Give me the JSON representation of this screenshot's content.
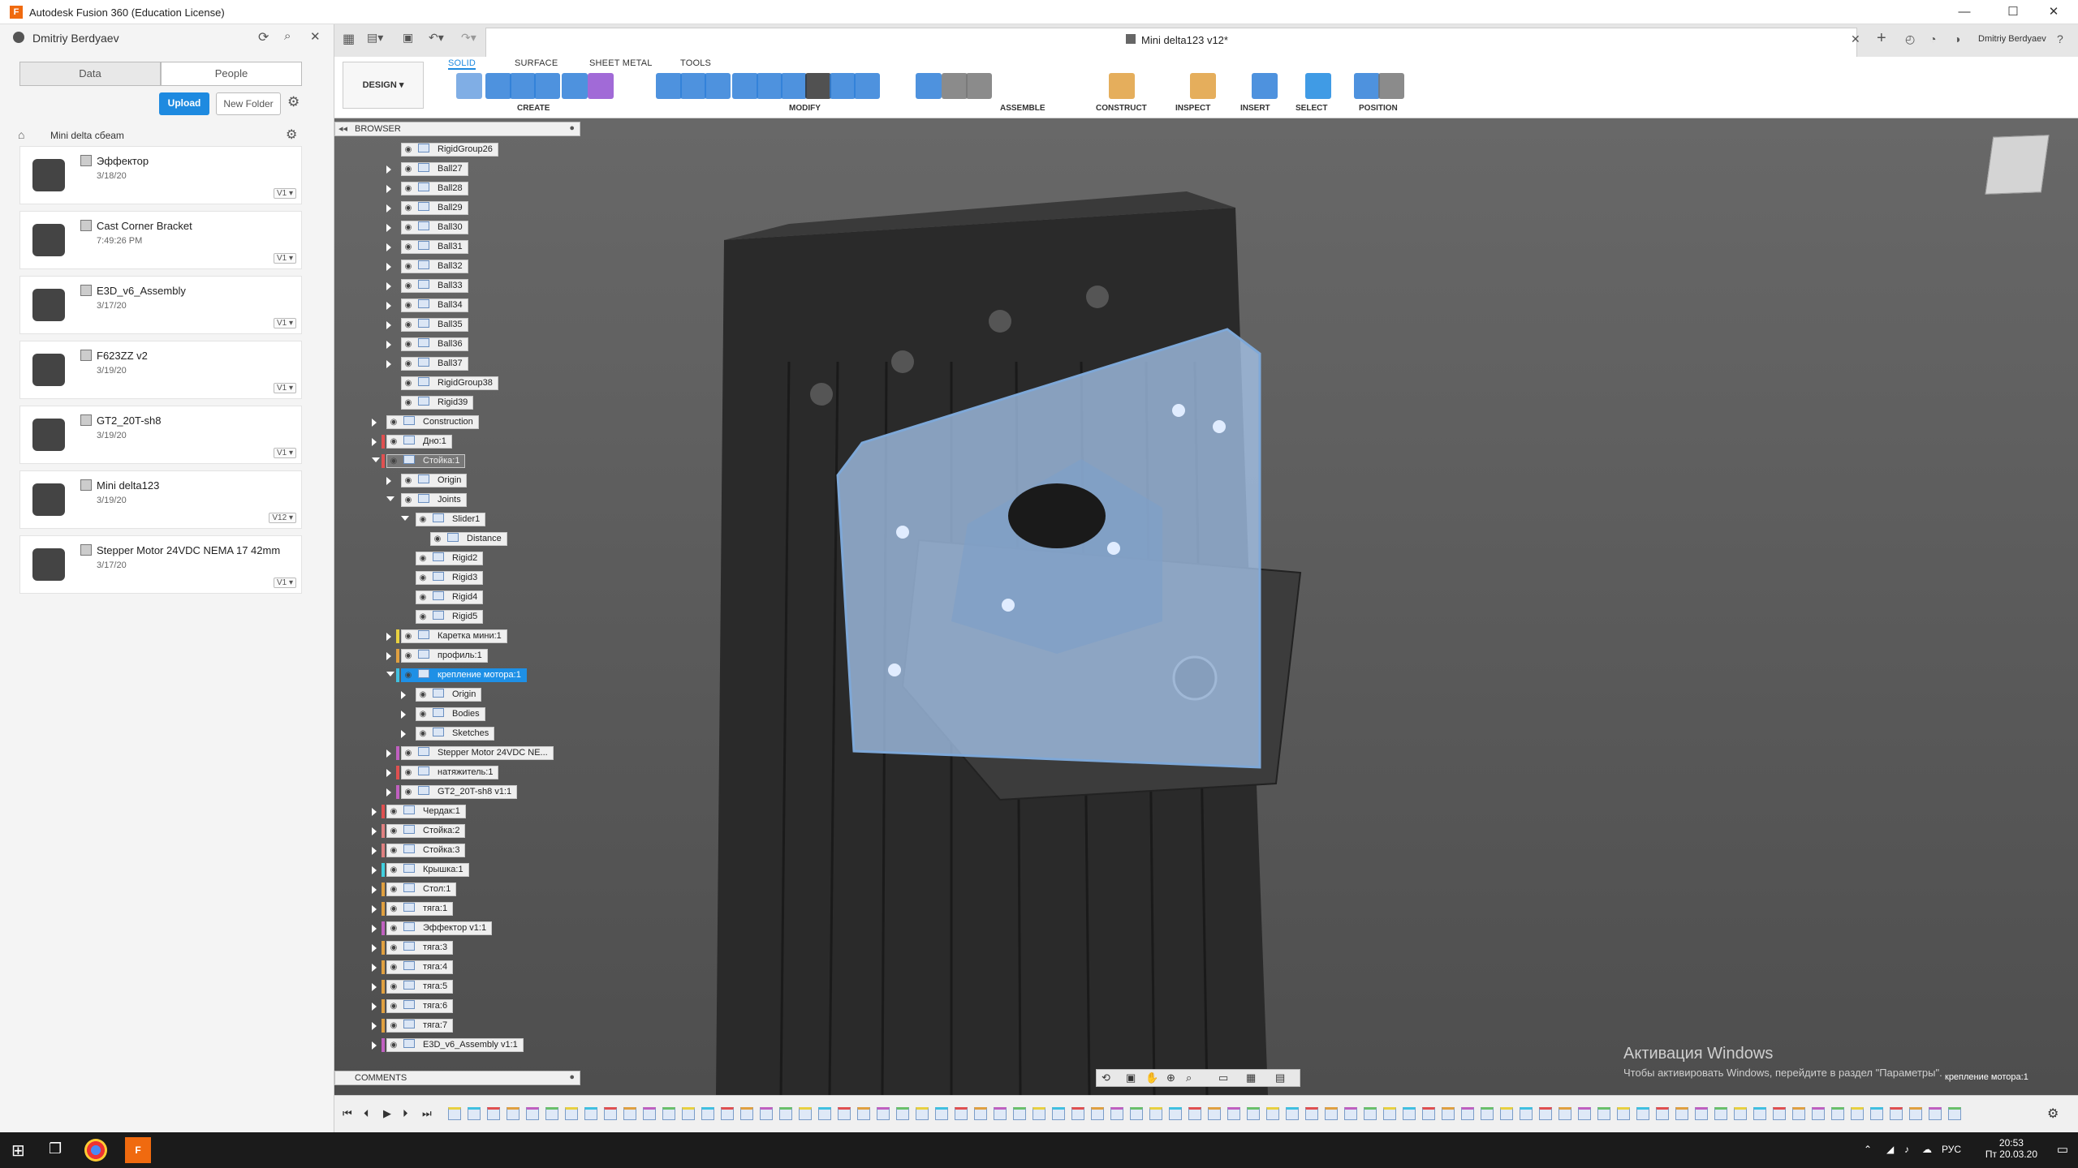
{
  "window": {
    "title": "Autodesk Fusion 360 (Education License)",
    "min": "—",
    "max": "☐",
    "close": "✕"
  },
  "user": {
    "name": "Dmitriy Berdyaev"
  },
  "data_panel": {
    "tabs": [
      {
        "label": "Data"
      },
      {
        "label": "People"
      }
    ],
    "upload_label": "Upload",
    "new_folder_label": "New Folder",
    "breadcrumb": "Mini delta cбeam",
    "items": [
      {
        "name": "Эффектор",
        "date": "3/18/20",
        "version": "V1"
      },
      {
        "name": "Cast Corner Bracket",
        "date": "7:49:26 PM",
        "version": "V1"
      },
      {
        "name": "E3D_v6_Assembly",
        "date": "3/17/20",
        "version": "V1"
      },
      {
        "name": "F623ZZ v2",
        "date": "3/19/20",
        "version": "V1"
      },
      {
        "name": "GT2_20T-sh8",
        "date": "3/19/20",
        "version": "V1"
      },
      {
        "name": "Mini delta123",
        "date": "3/19/20",
        "version": "V12"
      },
      {
        "name": "Stepper Motor 24VDC NEMA 17 42mm",
        "date": "3/17/20",
        "version": "V1"
      }
    ]
  },
  "document": {
    "title": "Mini delta123 v12*",
    "user": "Dmitriy Berdyaev"
  },
  "toolbar": {
    "workspace": "DESIGN",
    "tabs": [
      "SOLID",
      "SURFACE",
      "SHEET METAL",
      "TOOLS"
    ],
    "groups": [
      "CREATE",
      "MODIFY",
      "ASSEMBLE",
      "CONSTRUCT",
      "INSPECT",
      "INSERT",
      "SELECT",
      "POSITION"
    ]
  },
  "browser": {
    "label": "BROWSER",
    "nodes": [
      {
        "label": "RigidGroup26",
        "indent": 2,
        "arrow": "none",
        "color": ""
      },
      {
        "label": "Ball27",
        "indent": 2,
        "arrow": "closed",
        "color": ""
      },
      {
        "label": "Ball28",
        "indent": 2,
        "arrow": "closed",
        "color": ""
      },
      {
        "label": "Ball29",
        "indent": 2,
        "arrow": "closed",
        "color": ""
      },
      {
        "label": "Ball30",
        "indent": 2,
        "arrow": "closed",
        "color": ""
      },
      {
        "label": "Ball31",
        "indent": 2,
        "arrow": "closed",
        "color": ""
      },
      {
        "label": "Ball32",
        "indent": 2,
        "arrow": "closed",
        "color": ""
      },
      {
        "label": "Ball33",
        "indent": 2,
        "arrow": "closed",
        "color": ""
      },
      {
        "label": "Ball34",
        "indent": 2,
        "arrow": "closed",
        "color": ""
      },
      {
        "label": "Ball35",
        "indent": 2,
        "arrow": "closed",
        "color": ""
      },
      {
        "label": "Ball36",
        "indent": 2,
        "arrow": "closed",
        "color": ""
      },
      {
        "label": "Ball37",
        "indent": 2,
        "arrow": "closed",
        "color": ""
      },
      {
        "label": "RigidGroup38",
        "indent": 2,
        "arrow": "none",
        "color": ""
      },
      {
        "label": "Rigid39",
        "indent": 2,
        "arrow": "none",
        "color": ""
      },
      {
        "label": "Construction",
        "indent": 1,
        "arrow": "closed",
        "color": ""
      },
      {
        "label": "Дно:1",
        "indent": 1,
        "arrow": "closed",
        "color": "#e05050"
      },
      {
        "label": "Стойка:1",
        "indent": 1,
        "arrow": "open",
        "color": "#e05050",
        "dark": true
      },
      {
        "label": "Origin",
        "indent": 2,
        "arrow": "closed",
        "color": ""
      },
      {
        "label": "Joints",
        "indent": 2,
        "arrow": "open",
        "color": ""
      },
      {
        "label": "Slider1",
        "indent": 3,
        "arrow": "open",
        "color": ""
      },
      {
        "label": "Distance",
        "indent": 4,
        "arrow": "none",
        "color": ""
      },
      {
        "label": "Rigid2",
        "indent": 3,
        "arrow": "none",
        "color": ""
      },
      {
        "label": "Rigid3",
        "indent": 3,
        "arrow": "none",
        "color": ""
      },
      {
        "label": "Rigid4",
        "indent": 3,
        "arrow": "none",
        "color": ""
      },
      {
        "label": "Rigid5",
        "indent": 3,
        "arrow": "none",
        "color": ""
      },
      {
        "label": "Каретка мини:1",
        "indent": 2,
        "arrow": "closed",
        "color": "#e8d040"
      },
      {
        "label": "профиль:1",
        "indent": 2,
        "arrow": "closed",
        "color": "#e0a040"
      },
      {
        "label": "крепление мотора:1",
        "indent": 2,
        "arrow": "open",
        "color": "#40c0e0",
        "sel": true
      },
      {
        "label": "Origin",
        "indent": 3,
        "arrow": "closed",
        "color": ""
      },
      {
        "label": "Bodies",
        "indent": 3,
        "arrow": "closed",
        "color": ""
      },
      {
        "label": "Sketches",
        "indent": 3,
        "arrow": "closed",
        "color": ""
      },
      {
        "label": "Stepper Motor 24VDC NE...",
        "indent": 2,
        "arrow": "closed",
        "color": "#c060c0"
      },
      {
        "label": "натяжитель:1",
        "indent": 2,
        "arrow": "closed",
        "color": "#e05050"
      },
      {
        "label": "GT2_20T-sh8 v1:1",
        "indent": 2,
        "arrow": "closed",
        "color": "#c060c0"
      },
      {
        "label": "Чердак:1",
        "indent": 1,
        "arrow": "closed",
        "color": "#e05050"
      },
      {
        "label": "Стойка:2",
        "indent": 1,
        "arrow": "closed",
        "color": "#e08080"
      },
      {
        "label": "Стойка:3",
        "indent": 1,
        "arrow": "closed",
        "color": "#e08080"
      },
      {
        "label": "Крышка:1",
        "indent": 1,
        "arrow": "closed",
        "color": "#40d0e0"
      },
      {
        "label": "Стол:1",
        "indent": 1,
        "arrow": "closed",
        "color": "#e0a040"
      },
      {
        "label": "тяга:1",
        "indent": 1,
        "arrow": "closed",
        "color": "#e0a040"
      },
      {
        "label": "Эффектор v1:1",
        "indent": 1,
        "arrow": "closed",
        "color": "#c060c0"
      },
      {
        "label": "тяга:3",
        "indent": 1,
        "arrow": "closed",
        "color": "#e0a040"
      },
      {
        "label": "тяга:4",
        "indent": 1,
        "arrow": "closed",
        "color": "#e0a040"
      },
      {
        "label": "тяга:5",
        "indent": 1,
        "arrow": "closed",
        "color": "#e0a040"
      },
      {
        "label": "тяга:6",
        "indent": 1,
        "arrow": "closed",
        "color": "#e0a040"
      },
      {
        "label": "тяга:7",
        "indent": 1,
        "arrow": "closed",
        "color": "#e0a040"
      },
      {
        "label": "E3D_v6_Assembly v1:1",
        "indent": 1,
        "arrow": "closed",
        "color": "#c060c0"
      }
    ]
  },
  "comments": {
    "label": "COMMENTS"
  },
  "activation": {
    "title": "Активация Windows",
    "text": "Чтобы активировать Windows, перейдите в раздел \"Параметры\"."
  },
  "selection_status": "крепление мотора:1",
  "taskbar": {
    "lang": "РУС",
    "time": "20:53",
    "date": "Пт 20.03.20"
  }
}
